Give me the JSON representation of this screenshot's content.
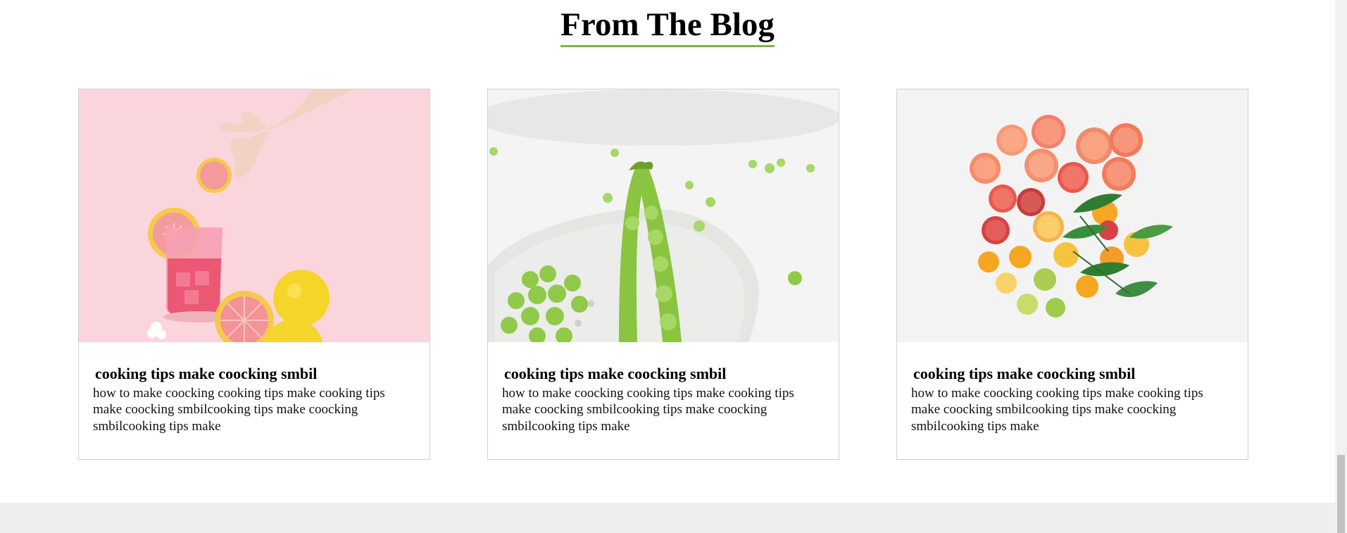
{
  "section": {
    "title": "From The Blog",
    "accent_color": "#7cb342"
  },
  "posts": [
    {
      "image": "pink-grapefruit-drink-photo",
      "title": "cooking tips make coocking smbil",
      "excerpt": "how to make coocking cooking tips make cooking tips make coocking smbilcooking tips make coocking smbilcooking tips make"
    },
    {
      "image": "green-peas-pod-photo",
      "title": "cooking tips make coocking smbil",
      "excerpt": "how to make coocking cooking tips make cooking tips make coocking smbilcooking tips make coocking smbilcooking tips make"
    },
    {
      "image": "citrus-slices-photo",
      "title": "cooking tips make coocking smbil",
      "excerpt": "how to make coocking cooking tips make cooking tips make coocking smbilcooking tips make coocking smbilcooking tips make"
    }
  ]
}
